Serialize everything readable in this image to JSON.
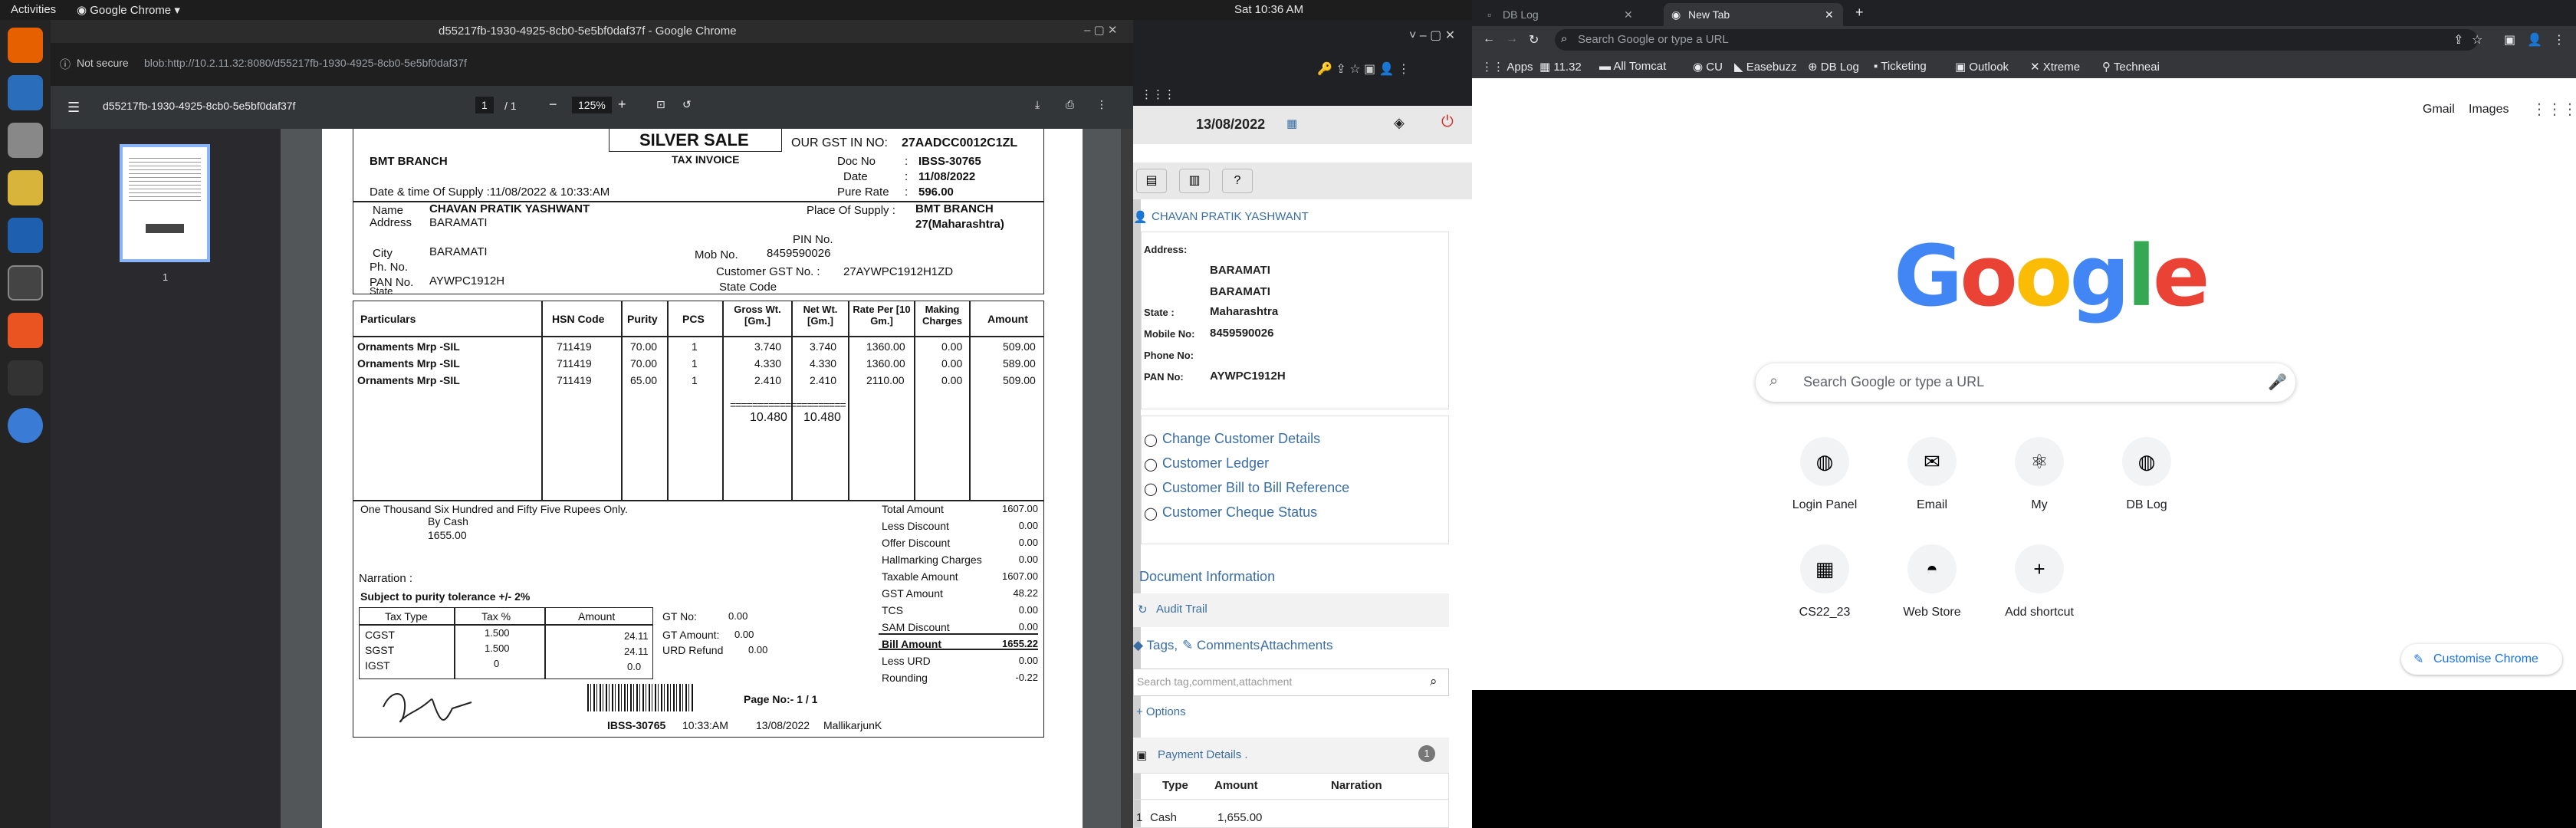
{
  "topbar": {
    "activities": "Activities",
    "app": "Google Chrome",
    "clock": "Sat 10:36 AM"
  },
  "pdf": {
    "window_title": "d55217fb-1930-4925-8cb0-5e5bf0daf37f - Google Chrome",
    "not_secure": "Not secure",
    "url": "blob:http://10.2.11.32:8080/d55217fb-1930-4925-8cb0-5e5bf0daf37f",
    "doc_name": "d55217fb-1930-4925-8cb0-5e5bf0daf37f",
    "page": "1",
    "page_total": "/ 1",
    "zoom": "125%",
    "thumb_label": "1",
    "invoice": {
      "header": "SILVER SALE",
      "gst_label": "OUR GST IN NO:",
      "gst": "27AADCC0012C1ZL",
      "branch": "BMT BRANCH",
      "tax_invoice": "TAX INVOICE",
      "doc_no_label": "Doc No",
      "doc_no": "IBSS-30765",
      "colon": ":",
      "date_label": "Date",
      "date": "11/08/2022",
      "pure_rate_label": "Pure Rate",
      "pure_rate": "596.00",
      "supply_time": "Date & time Of Supply :11/08/2022 &  10:33:AM",
      "name_label": "Name",
      "name": "CHAVAN PRATIK YASHWANT",
      "address_label": "Address",
      "address": "BARAMATI",
      "pos_label": "Place Of Supply :",
      "pos1": "BMT BRANCH",
      "pos2": "27(Maharashtra)",
      "pin_label": "PIN No.",
      "city_label": "City",
      "city": "BARAMATI",
      "ph_label": "Ph. No.",
      "mob_label": "Mob No.",
      "mob": "8459590026",
      "cgst_no_label": "Customer GST No. :",
      "cgst_no": "27AYWPC1912H1ZD",
      "pan_label": "PAN No.",
      "pan": "AYWPC1912H",
      "state_label": "State",
      "state_code_label": "State Code",
      "cols": [
        "Particulars",
        "HSN Code",
        "Purity",
        "PCS",
        "Gross Wt. [Gm.]",
        "Net Wt. [Gm.]",
        "Rate Per [10 Gm.]",
        "Making Charges",
        "Amount"
      ],
      "rows": [
        [
          "Ornaments Mrp -SIL",
          "711419",
          "70.00",
          "1",
          "3.740",
          "3.740",
          "1360.00",
          "0.00",
          "509.00"
        ],
        [
          "Ornaments Mrp -SIL",
          "711419",
          "70.00",
          "1",
          "4.330",
          "4.330",
          "1360.00",
          "0.00",
          "589.00"
        ],
        [
          "Ornaments Mrp -SIL",
          "711419",
          "65.00",
          "1",
          "2.410",
          "2.410",
          "2110.00",
          "0.00",
          "509.00"
        ]
      ],
      "sep": "=====================",
      "tot_gross": "10.480",
      "tot_net": "10.480",
      "words": "One Thousand Six Hundred and Fifty Five Rupees Only.",
      "by_cash": "By Cash",
      "cash_amt": "1655.00",
      "summary": [
        [
          "Total Amount",
          "1607.00"
        ],
        [
          "Less Discount",
          "0.00"
        ],
        [
          "Offer Discount",
          "0.00"
        ],
        [
          "Hallmarking Charges",
          "0.00"
        ],
        [
          "Taxable Amount",
          "1607.00"
        ],
        [
          "GST Amount",
          "48.22"
        ],
        [
          "TCS",
          "0.00"
        ],
        [
          "SAM Discount",
          "0.00"
        ],
        [
          "Bill Amount",
          "1655.22"
        ],
        [
          "Less URD",
          "0.00"
        ],
        [
          "Rounding",
          "-0.22"
        ]
      ],
      "narration": "Narration :",
      "tolerance": "Subject to purity tolerance +/- 2%",
      "tax_cols": [
        "Tax Type",
        "Tax %",
        "Amount"
      ],
      "tax_rows": [
        [
          "CGST",
          "1.500",
          "24.11"
        ],
        [
          "SGST",
          "1.500",
          "24.11"
        ],
        [
          "IGST",
          "0",
          "0.0"
        ]
      ],
      "gt_no_label": "GT No:",
      "gt_no": "0.00",
      "gt_amt_label": "GT Amount:",
      "gt_amt": "0.00",
      "urd_label": "URD Refund",
      "urd": "0.00",
      "page_no": "Page No:- 1 / 1",
      "foot_doc": "IBSS-30765",
      "foot_time": "10:33:AM",
      "foot_date": "13/08/2022",
      "foot_user": "MallikarjunK"
    }
  },
  "mid": {
    "date": "13/08/2022",
    "customer": "CHAVAN PRATIK YASHWANT",
    "address_label": "Address:",
    "addr1": "BARAMATI",
    "addr2": "BARAMATI",
    "state_label": "State :",
    "state": "Maharashtra",
    "mobile_label": "Mobile No:",
    "mobile": "8459590026",
    "phone_label": "Phone No:",
    "pan_label": "PAN No:",
    "pan": "AYWPC1912H",
    "links": [
      "Change Customer Details",
      "Customer Ledger",
      "Customer Bill to Bill Reference",
      "Customer Cheque Status"
    ],
    "doc_info": "Document Information",
    "audit": "Audit Trail",
    "tags": "Tags,",
    "comments": "Comments,",
    "attachments": "Attachments",
    "search_placeholder": "Search tag,comment,attachment",
    "options": "+ Options",
    "payment": "Payment Details .",
    "payment_count": "1",
    "pay_cols": [
      "Type",
      "Amount",
      "Narration"
    ],
    "pay_row": [
      "1",
      "Cash",
      "1,655.00",
      ""
    ]
  },
  "chrome": {
    "tab1": "DB Log",
    "tab2": "New Tab",
    "address_placeholder": "Search Google or type a URL",
    "bookmarks": [
      "Apps",
      "11.32",
      "All Tomcat",
      "CU",
      "Easebuzz",
      "DB Log",
      "Ticketing",
      "Outlook",
      "Xtreme",
      "Techneai"
    ],
    "gmail": "Gmail",
    "images": "Images",
    "search_placeholder": "Search Google or type a URL",
    "shortcuts": [
      "Login Panel",
      "Email",
      "My",
      "DB Log",
      "CS22_23",
      "Web Store",
      "Add shortcut"
    ],
    "customise": "Customise Chrome",
    "brand": {
      "blue": "#4285F4",
      "red": "#EA4335",
      "yellow": "#FBBC05",
      "green": "#34A853"
    }
  }
}
